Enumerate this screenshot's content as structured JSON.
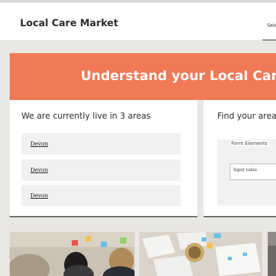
{
  "header": {
    "brand": "Local Care Market",
    "nav_link": "Sele"
  },
  "hero": {
    "title": "Understand your Local Care M"
  },
  "areas_panel": {
    "heading": "We are currently live in 3 areas",
    "areas": [
      "Devon",
      "Devon",
      "Devon"
    ]
  },
  "find_panel": {
    "heading": "Find your area",
    "form_legend": "Form Elements",
    "input_value": "Input value"
  },
  "colors": {
    "hero_background": "#f07a56",
    "page_background": "#e9e7e4"
  }
}
